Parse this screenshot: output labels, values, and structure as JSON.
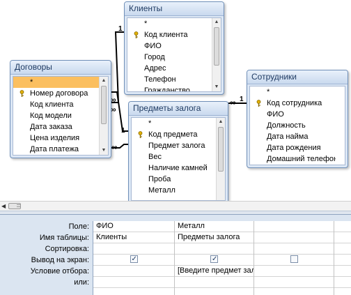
{
  "tables": {
    "clients": {
      "title": "Клиенты",
      "fields": [
        "*",
        "Код клиента",
        "ФИО",
        "Город",
        "Адрес",
        "Телефон",
        "Гражданство"
      ]
    },
    "contracts": {
      "title": "Договоры",
      "fields": [
        "*",
        "Номер договора",
        "Код клиента",
        "Код модели",
        "Дата заказа",
        "Цена изделия",
        "Дата платежа"
      ]
    },
    "collateral": {
      "title": "Предметы залога",
      "fields": [
        "*",
        "Код предмета",
        "Предмет залога",
        "Вес",
        "Наличие камней",
        "Проба",
        "Металл"
      ]
    },
    "employees": {
      "title": "Сотрудники",
      "fields": [
        "*",
        "Код сотрудника",
        "ФИО",
        "Должность",
        "Дата найма",
        "Дата рождения",
        "Домашний телефон"
      ]
    }
  },
  "joins": {
    "one": "1",
    "many": "∞"
  },
  "grid": {
    "row_labels": [
      "Поле:",
      "Имя таблицы:",
      "Сортировка:",
      "Вывод на экран:",
      "Условие отбора:",
      "или:"
    ],
    "columns": [
      {
        "field": "ФИО",
        "table": "Клиенты",
        "sort": "",
        "show": true,
        "criteria": "",
        "or": ""
      },
      {
        "field": "Металл",
        "table": "Предметы залога",
        "sort": "",
        "show": true,
        "criteria": "[Введите предмет залога]",
        "or": ""
      },
      {
        "field": "",
        "table": "",
        "sort": "",
        "show": false,
        "criteria": "",
        "or": ""
      },
      {
        "field": "",
        "table": "",
        "sort": "",
        "show": null,
        "criteria": "",
        "or": ""
      }
    ]
  },
  "colors": {
    "table_border": "#6f8fb8",
    "selected_row": "#fbbf5f",
    "grid_background": "#dbe5f1",
    "join_line": "#000000"
  },
  "icons": {
    "primary_key": "key-icon"
  }
}
